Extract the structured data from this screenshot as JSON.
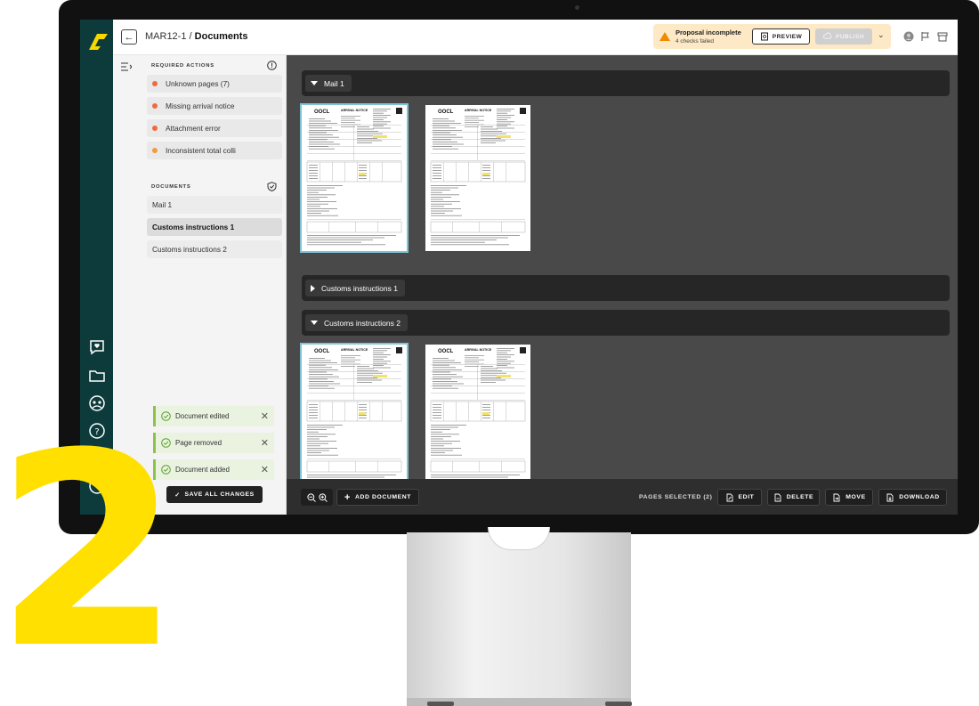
{
  "header": {
    "breadcrumb_id": "MAR12-1",
    "breadcrumb_sep": "/",
    "breadcrumb_page": "Documents"
  },
  "status": {
    "title": "Proposal incomplete",
    "subtitle": "4 checks failed",
    "preview_label": "PREVIEW",
    "publish_label": "PUBLISH",
    "warning_color": "#f08a00"
  },
  "sidebar": {
    "required_title": "REQUIRED ACTIONS",
    "required_items": [
      {
        "label": "Unknown pages (7)"
      },
      {
        "label": "Missing arrival notice"
      },
      {
        "label": "Attachment error"
      },
      {
        "label": "Inconsistent total colli"
      }
    ],
    "documents_title": "DOCUMENTS",
    "documents": [
      {
        "label": "Mail 1",
        "active": false
      },
      {
        "label": "Customs instructions 1",
        "active": true
      },
      {
        "label": "Customs instructions 2",
        "active": false
      }
    ]
  },
  "toasts": [
    {
      "label": "Document edited"
    },
    {
      "label": "Page removed"
    },
    {
      "label": "Document added"
    }
  ],
  "save_label": "SAVE ALL CHANGES",
  "groups": [
    {
      "label": "Mail 1",
      "expanded": true
    },
    {
      "label": "Customs instructions 1",
      "expanded": false
    },
    {
      "label": "Customs instructions 2",
      "expanded": true
    }
  ],
  "page_thumb": {
    "title": "ARRIVAL NOTICE",
    "brand": "OOCL"
  },
  "actions": {
    "add_document": "ADD DOCUMENT",
    "pages_selected": "PAGES SELECTED (2)",
    "edit": "EDIT",
    "delete": "DELETE",
    "move": "MOVE",
    "download": "DOWNLOAD"
  },
  "overlay_number": "2",
  "colors": {
    "rail": "#0d3b3b",
    "logo": "#f5d800",
    "overlay": "#ffe000",
    "selection": "#7fc4d6",
    "toast_accent": "#8bc34a"
  }
}
